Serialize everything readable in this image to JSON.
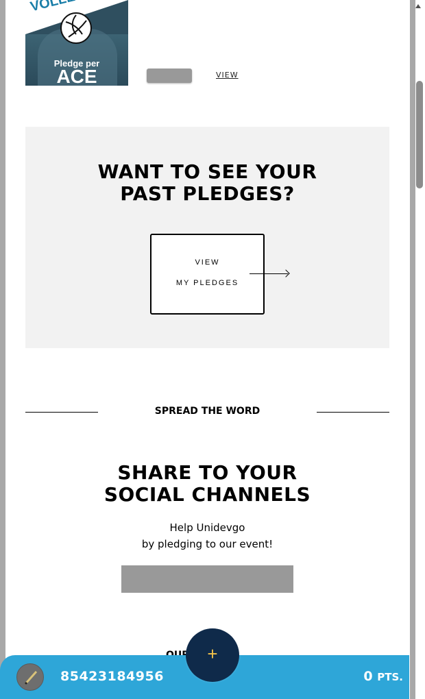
{
  "campaign_card": {
    "image_title": "VOLLEYBA",
    "image_line1": "Pledge per",
    "image_line2": "ACE",
    "view_link": "VIEW"
  },
  "past_pledges": {
    "title_line1": "WANT TO SEE YOUR",
    "title_line2": "PAST PLEDGES?",
    "button_line1": "VIEW",
    "button_line2": "MY PLEDGES"
  },
  "spread": {
    "heading": "SPREAD THE WORD"
  },
  "share": {
    "title_line1": "SHARE TO YOUR",
    "title_line2": "SOCIAL CHANNELS",
    "subtitle_line1": "Help Unidevgo",
    "subtitle_line2": "by pledging to our event!"
  },
  "next_section": {
    "partial_heading": "OUR TEAM"
  },
  "bottom_bar": {
    "account_number": "85423184956",
    "points_value": "0",
    "points_unit": "PTS.",
    "fab_symbol": "+"
  },
  "colors": {
    "bottom_bar": "#2ea6d8",
    "fab": "#0f2a4a",
    "fab_icon": "#f3c24a",
    "panel": "#f2f2f2",
    "placeholder_button": "#999999"
  }
}
